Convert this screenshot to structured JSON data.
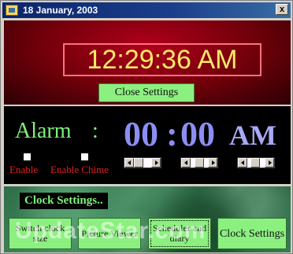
{
  "window": {
    "title": "18 January, 2003",
    "close_glyph": "x"
  },
  "clock": {
    "time": "12:29:36 AM",
    "close_settings_label": "Close Settings"
  },
  "alarm": {
    "label": "Alarm",
    "colon": ":",
    "hours": "00",
    "separator": ":",
    "minutes": "00",
    "ampm": "AM",
    "enable_label": "Enable",
    "enable_chime_label": "Enable Chime",
    "hours_scroll_level": 0.0,
    "minutes_scroll_level": 0.5,
    "ampm_scroll_level": 0.35
  },
  "settings": {
    "title": "Clock Settings..",
    "buttons": [
      {
        "label": "Switch clock size"
      },
      {
        "label": "Picture Viewer"
      },
      {
        "label": "Scheduler and diary"
      },
      {
        "label": "Clock Settings"
      }
    ]
  },
  "watermark": "UpdateStar.com",
  "colors": {
    "titlebar": "#0a246a",
    "clock_digits": "#ffe86a",
    "alarm_green": "#7ef27a",
    "alarm_time_blue": "#8b8ef2",
    "checkbox_labels": "#e02020",
    "button_green": "#8cf080"
  }
}
